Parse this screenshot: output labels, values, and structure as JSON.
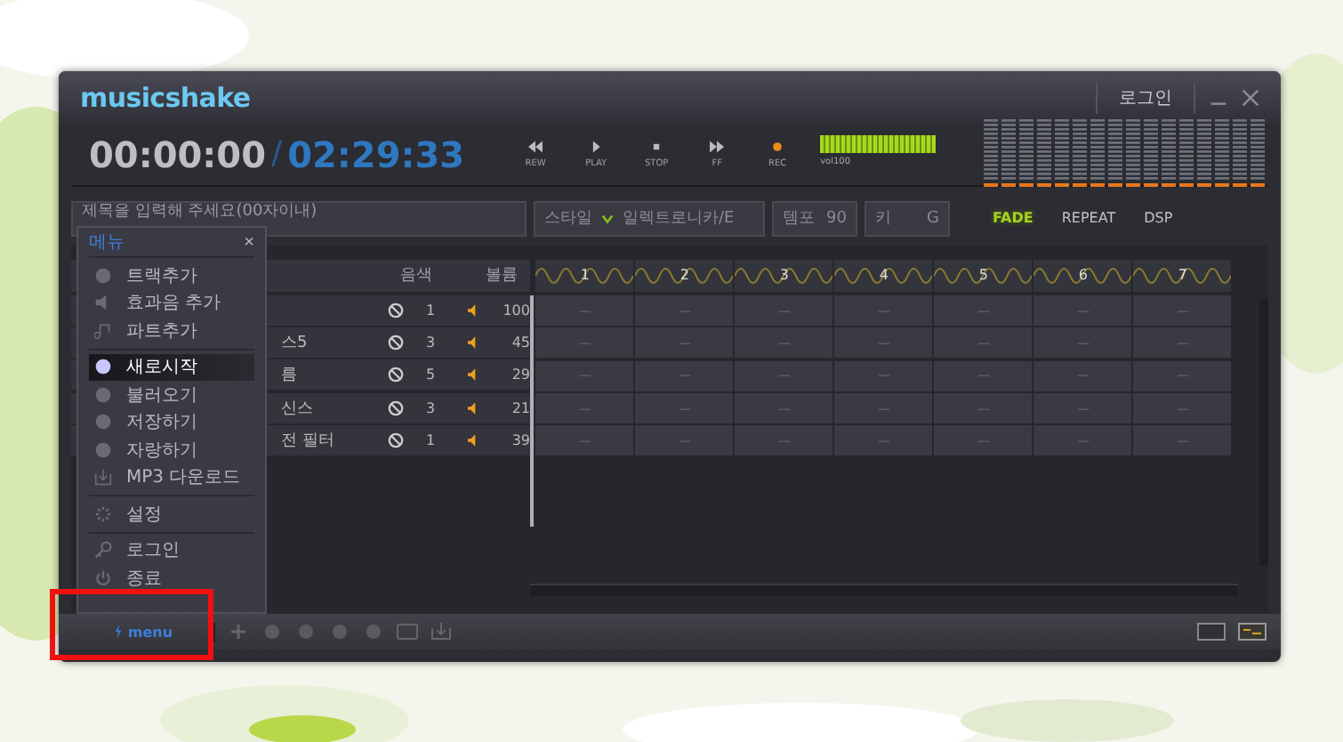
{
  "app": {
    "logo": "musicshake",
    "login": "로그인"
  },
  "transport": {
    "elapsed": "00:00:00",
    "separator": "/",
    "total": "02:29:33",
    "buttons": [
      {
        "label": "REW",
        "kind": "rew"
      },
      {
        "label": "PLAY",
        "kind": "play"
      },
      {
        "label": "STOP",
        "kind": "stop"
      },
      {
        "label": "FF",
        "kind": "ff"
      },
      {
        "label": "REC",
        "kind": "rec"
      }
    ],
    "volume": {
      "label": "vol100",
      "level": 1
    }
  },
  "options": {
    "title_field": {
      "placeholder": "제목을 입력해 주세요(00자이내)"
    },
    "style": {
      "label": "스타일",
      "value": "일렉트로니카/E"
    },
    "tempo": {
      "label": "템포",
      "value": "90"
    },
    "key": {
      "label": "키",
      "value": "G"
    },
    "toggles": [
      {
        "label": "FADE",
        "on": true
      },
      {
        "label": "REPEAT",
        "on": false
      },
      {
        "label": "DSP",
        "on": false
      }
    ]
  },
  "tracks": {
    "columns": [
      "음색",
      "볼륨"
    ],
    "rows": [
      {
        "tone": "1",
        "volume": "100"
      },
      {
        "name": "스5",
        "tone": "3",
        "volume": "45"
      },
      {
        "name": "름",
        "tone": "5",
        "volume": "29"
      },
      {
        "name": "신스",
        "tone": "3",
        "volume": "21"
      },
      {
        "name": "전 필터",
        "tone": "1",
        "volume": "39"
      }
    ]
  },
  "grid": {
    "measures": [
      "1",
      "2",
      "3",
      "4",
      "5",
      "6",
      "7"
    ],
    "rows": [
      [
        "—",
        "—",
        "—",
        "—",
        "—",
        "—",
        "—"
      ],
      [
        "—",
        "—",
        "—",
        "—",
        "—",
        "—",
        "—"
      ],
      [
        "—",
        "—",
        "—",
        "—",
        "—",
        "—",
        "—"
      ],
      [
        "—",
        "—",
        "—",
        "—",
        "—",
        "—",
        "—"
      ],
      [
        "—",
        "—",
        "—",
        "—",
        "—",
        "—",
        "—"
      ]
    ]
  },
  "menu": {
    "title": "메뉴",
    "close": "×",
    "groups": [
      [
        {
          "label": "트랙추가",
          "selected": false
        },
        {
          "label": "효과음 추가",
          "selected": false
        },
        {
          "label": "파트추가",
          "selected": false
        }
      ],
      [
        {
          "label": "새로시작",
          "selected": true
        },
        {
          "label": "불러오기",
          "selected": false
        },
        {
          "label": "저장하기",
          "selected": false
        },
        {
          "label": "자랑하기",
          "selected": false
        },
        {
          "label": "MP3 다운로드",
          "selected": false
        }
      ],
      [
        {
          "label": "설정",
          "selected": false
        }
      ],
      [
        {
          "label": "로그인",
          "selected": false
        },
        {
          "label": "종료",
          "selected": false
        }
      ]
    ]
  },
  "bottom_bar": {
    "menu_button": "menu"
  }
}
